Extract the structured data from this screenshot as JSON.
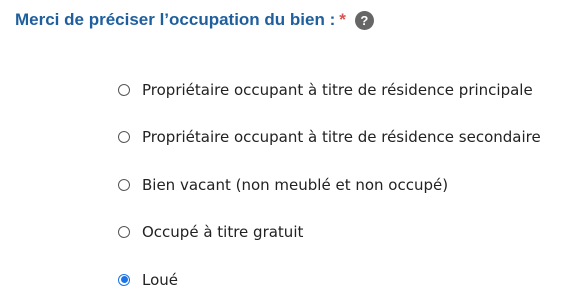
{
  "question": {
    "label": "Merci de préciser l’occupation du bien :",
    "required_marker": "*",
    "help_icon_glyph": "?"
  },
  "options": [
    {
      "label": "Propriétaire occupant à titre de résidence principale",
      "selected": false
    },
    {
      "label": "Propriétaire occupant à titre de résidence secondaire",
      "selected": false
    },
    {
      "label": "Bien vacant (non meublé et non occupé)",
      "selected": false
    },
    {
      "label": "Occupé à titre gratuit",
      "selected": false
    },
    {
      "label": "Loué",
      "selected": true
    }
  ],
  "colors": {
    "question_text": "#1f5f9e",
    "required_star": "#d9534f",
    "help_icon_bg": "#666666",
    "radio_selected": "#1a73e8",
    "option_text": "#222222"
  },
  "icons": {
    "help": "help-icon",
    "radio_unselected": "radio-unselected-icon",
    "radio_selected": "radio-selected-icon"
  }
}
